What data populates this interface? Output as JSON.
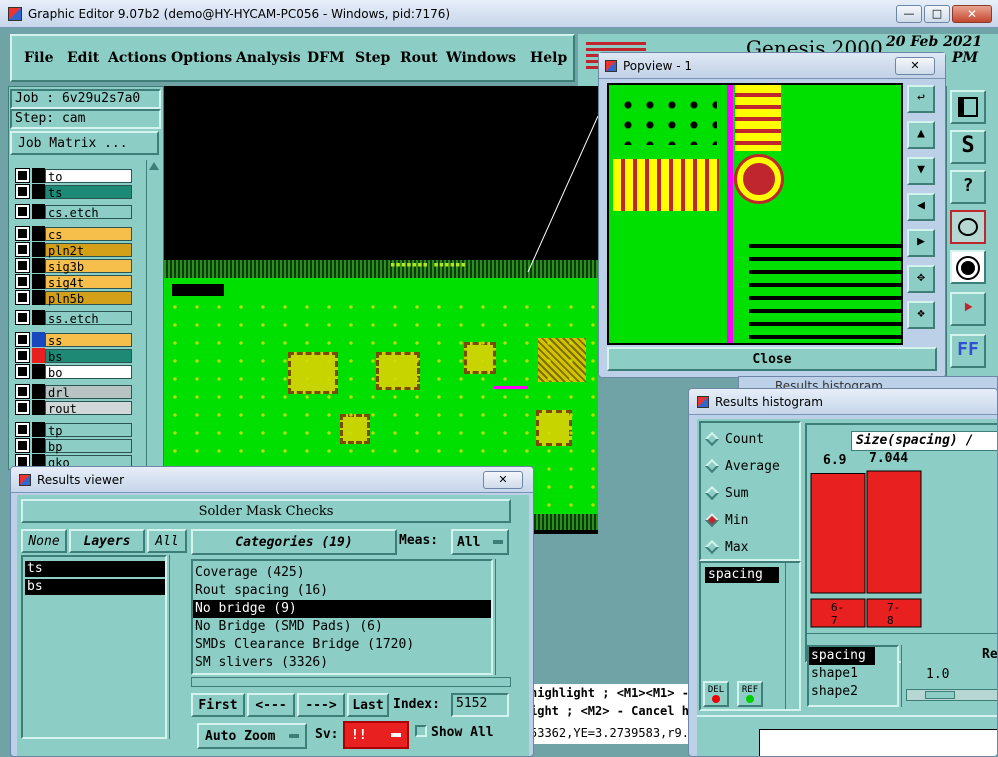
{
  "window": {
    "title": "Graphic Editor 9.07b2 (demo@HY-HYCAM-PC056 - Windows, pid:7176)"
  },
  "menu": [
    "File",
    "Edit",
    "Actions",
    "Options",
    "Analysis",
    "DFM",
    "Step",
    "Rout",
    "Windows",
    "Help"
  ],
  "brand": {
    "title": "Genesis 2000",
    "date": "20 Feb 2021",
    "time": "PM"
  },
  "job": {
    "job_label": "Job : 6v29u2s7a0",
    "step_label": "Step: cam",
    "matrix_button": "Job Matrix ..."
  },
  "layers": [
    {
      "name": "to",
      "color": "#ffffff"
    },
    {
      "name": "ts",
      "color": "#1e8a76"
    },
    {
      "name": "cs.etch",
      "color": "#8ccdc5"
    },
    {
      "name": "cs",
      "color": "#f6be4b"
    },
    {
      "name": "pln2t",
      "color": "#d4a017"
    },
    {
      "name": "sig3b",
      "color": "#f6be4b"
    },
    {
      "name": "sig4t",
      "color": "#f6be4b"
    },
    {
      "name": "pln5b",
      "color": "#d4a017"
    },
    {
      "name": "ss.etch",
      "color": "#8ccdc5"
    },
    {
      "name": "ss",
      "color": "#f6be4b"
    },
    {
      "name": "bs",
      "color": "#1e8a76"
    },
    {
      "name": "bo",
      "color": "#ffffff"
    },
    {
      "name": "drl",
      "color": "#b8c4c4"
    },
    {
      "name": "rout",
      "color": "#d0d8d8"
    },
    {
      "name": "tp",
      "color": "#8ccdc5"
    },
    {
      "name": "bp",
      "color": "#8ccdc5"
    },
    {
      "name": "gko",
      "color": "#8ccdc5"
    }
  ],
  "popview": {
    "title": "Popview - 1",
    "close_label": "Close"
  },
  "canvas_text": {
    "hl1": "highlight ; <M1><M1> -",
    "hl2": "ight ; <M2> - Cancel h",
    "coords": "53362,YE=3.2739583,r9."
  },
  "results_viewer": {
    "title": "Results viewer",
    "header": "Solder Mask Checks",
    "none_label": "None",
    "layers_label": "Layers",
    "all_label": "All",
    "layer_items": [
      "ts",
      "bs"
    ],
    "categories_label": "Categories (19)",
    "meas_label": "Meas:",
    "meas_value": "All",
    "categories": [
      "Coverage (425)",
      "Rout spacing (16)",
      "No bridge (9)",
      "No Bridge (SMD Pads) (6)",
      "SMDs Clearance Bridge (1720)",
      "SM slivers (3326)"
    ],
    "selected_category_index": 2,
    "first_label": "First",
    "prev_label": "<---",
    "next_label": "--->",
    "last_label": "Last",
    "index_label": "Index:",
    "index_value": "5152",
    "auto_zoom_label": "Auto Zoom",
    "sv_label": "Sv:",
    "sv_value": "!!",
    "show_all_label": "Show All"
  },
  "histogram": {
    "title": "Results histogram",
    "shadow_title": "Results histogram",
    "radios": [
      {
        "label": "Count",
        "selected": false
      },
      {
        "label": "Average",
        "selected": false
      },
      {
        "label": "Sum",
        "selected": false
      },
      {
        "label": "Min",
        "selected": true
      },
      {
        "label": "Max",
        "selected": false
      }
    ],
    "field_label": "spacing",
    "del_label": "DEL",
    "ref_label": "REF",
    "size_label": "Size(spacing) /",
    "value1": "6.9",
    "value2": "7.044",
    "chart_data": {
      "type": "bar",
      "categories": [
        "6-7",
        "7-8"
      ],
      "values": [
        6.9,
        7.044
      ]
    },
    "bin_labels": [
      "6-\n7",
      "7-\n8"
    ],
    "list_items": [
      "spacing",
      "shape1",
      "shape2"
    ],
    "ratio_label": "Re",
    "ratio_value": "1.0"
  }
}
